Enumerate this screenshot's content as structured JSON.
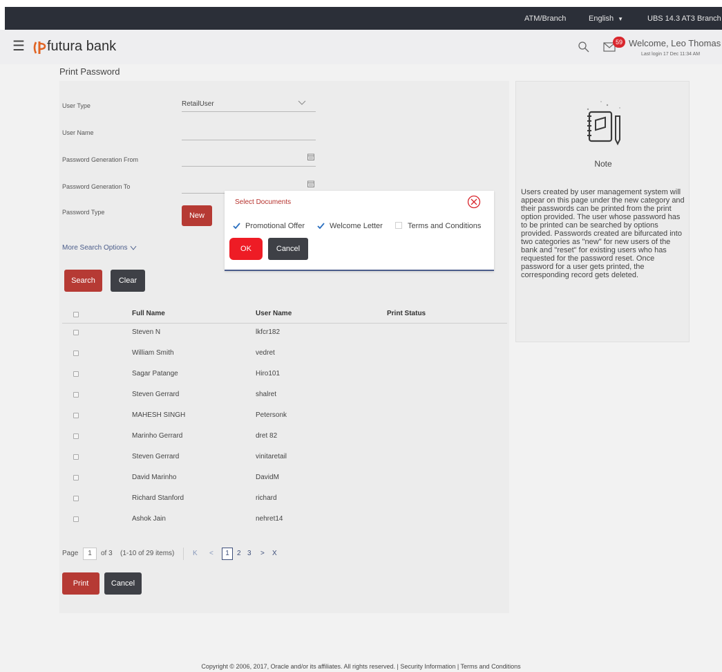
{
  "topbar": {
    "atm_branch": "ATM/Branch",
    "language": "English",
    "branch": "UBS 14.3 AT3 Branch"
  },
  "header": {
    "logo": "futura bank",
    "notification_count": "59",
    "welcome": "Welcome, Leo Thomas",
    "last_login": "Last login 17 Dec 11:34 AM"
  },
  "page": {
    "title": "Print Password"
  },
  "form": {
    "user_type_label": "User Type",
    "user_type_value": "RetailUser",
    "user_name_label": "User Name",
    "user_name_value": "",
    "gen_from_label": "Password Generation From",
    "gen_from_value": "",
    "gen_to_label": "Password Generation To",
    "gen_to_value": "",
    "pwd_type_label": "Password Type",
    "pwd_type_value": "New",
    "more_options": "More Search Options",
    "search_label": "Search",
    "clear_label": "Clear"
  },
  "table": {
    "columns": [
      "Full Name",
      "User Name",
      "Print Status"
    ],
    "rows": [
      {
        "full_name": "Steven N",
        "user_name": "lkfcr182",
        "status": ""
      },
      {
        "full_name": "William Smith",
        "user_name": "vedret",
        "status": ""
      },
      {
        "full_name": "Sagar Patange",
        "user_name": "Hiro101",
        "status": ""
      },
      {
        "full_name": "Steven Gerrard",
        "user_name": "shalret",
        "status": ""
      },
      {
        "full_name": "MAHESH SINGH",
        "user_name": "Petersonk",
        "status": ""
      },
      {
        "full_name": "Marinho Gerrard",
        "user_name": "dret 82",
        "status": ""
      },
      {
        "full_name": "Steven Gerrard",
        "user_name": "vinitaretail",
        "status": ""
      },
      {
        "full_name": "David Marinho",
        "user_name": "DavidM",
        "status": ""
      },
      {
        "full_name": "Richard Stanford",
        "user_name": "richard",
        "status": ""
      },
      {
        "full_name": "Ashok Jain",
        "user_name": "nehret14",
        "status": ""
      }
    ]
  },
  "pagination": {
    "page_label": "Page",
    "current": "1",
    "of_total": "of 3",
    "range": "(1-10 of 29 items)",
    "first": "K",
    "prev": "<",
    "pages": [
      "1",
      "2",
      "3"
    ],
    "next": ">",
    "last": "X"
  },
  "actions": {
    "print_label": "Print",
    "cancel_label": "Cancel"
  },
  "note": {
    "title": "Note",
    "body": "Users created by user management system will appear on this page under the new category and their passwords can be printed from the print option provided. The user whose password has to be printed can be searched by options provided. Passwords created are bifurcated into two categories as \"new\" for new users of the bank and \"reset\" for existing users who has requested for the password reset. Once password for a user gets printed, the corresponding record gets deleted."
  },
  "modal": {
    "title": "Select Documents",
    "options": [
      {
        "label": "Promotional Offer",
        "checked": true
      },
      {
        "label": "Welcome Letter",
        "checked": true
      },
      {
        "label": "Terms and Conditions",
        "checked": false
      }
    ],
    "ok_label": "OK",
    "cancel_label": "Cancel"
  },
  "footer": {
    "text": "Copyright © 2006, 2017, Oracle and/or its affiliates. All rights reserved. | Security Information | Terms and Conditions"
  },
  "colors": {
    "brand_red": "#b63a34",
    "ok_red": "#ee1c25",
    "dark": "#2b2f38",
    "link": "#4a5c8a",
    "badge": "#d9272e"
  },
  "icons": [
    "hamburger-icon",
    "futura-logo-icon",
    "search-icon",
    "mail-icon",
    "chevron-down-icon",
    "calendar-icon",
    "note-icon",
    "close-circle-icon",
    "check-icon"
  ]
}
